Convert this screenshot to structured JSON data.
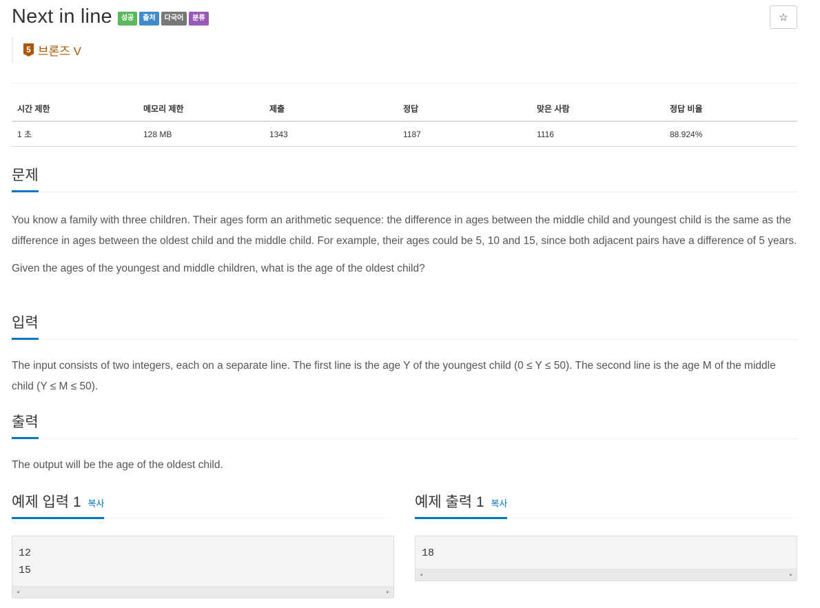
{
  "problem": {
    "title": "Next in line",
    "labels": [
      {
        "text": "성공",
        "color": "#5cb85c"
      },
      {
        "text": "출처",
        "color": "#428bca"
      },
      {
        "text": "다국어",
        "color": "#777777"
      },
      {
        "text": "분류",
        "color": "#9b59b6"
      }
    ],
    "star_icon": "☆",
    "tier": {
      "badge_number": "5",
      "text": "브론즈 V",
      "color": "#ad5600"
    }
  },
  "stats": {
    "headers": [
      "시간 제한",
      "메모리 제한",
      "제출",
      "정답",
      "맞은 사람",
      "정답 비율"
    ],
    "values": [
      "1 초",
      "128 MB",
      "1343",
      "1187",
      "1116",
      "88.924%"
    ]
  },
  "sections": {
    "problem": {
      "title": "문제",
      "paragraphs": [
        "You know a family with three children. Their ages form an arithmetic sequence: the difference in ages between the middle child and youngest child is the same as the difference in ages between the oldest child and the middle child. For example, their ages could be 5, 10 and 15, since both adjacent pairs have a difference of 5 years.",
        "Given the ages of the youngest and middle children, what is the age of the oldest child?"
      ]
    },
    "input": {
      "title": "입력",
      "text": "The input consists of two integers, each on a separate line. The first line is the age Y of the youngest child (0 ≤ Y ≤ 50). The second line is the age M of the middle child (Y ≤ M ≤ 50)."
    },
    "output": {
      "title": "출력",
      "text": "The output will be the age of the oldest child."
    }
  },
  "samples": {
    "input": {
      "title": "예제 입력 1",
      "copy": "복사",
      "content": "12\n15"
    },
    "output": {
      "title": "예제 출력 1",
      "copy": "복사",
      "content": "18"
    }
  },
  "scroll": {
    "left_arrow": "◂",
    "right_arrow": "▸"
  }
}
